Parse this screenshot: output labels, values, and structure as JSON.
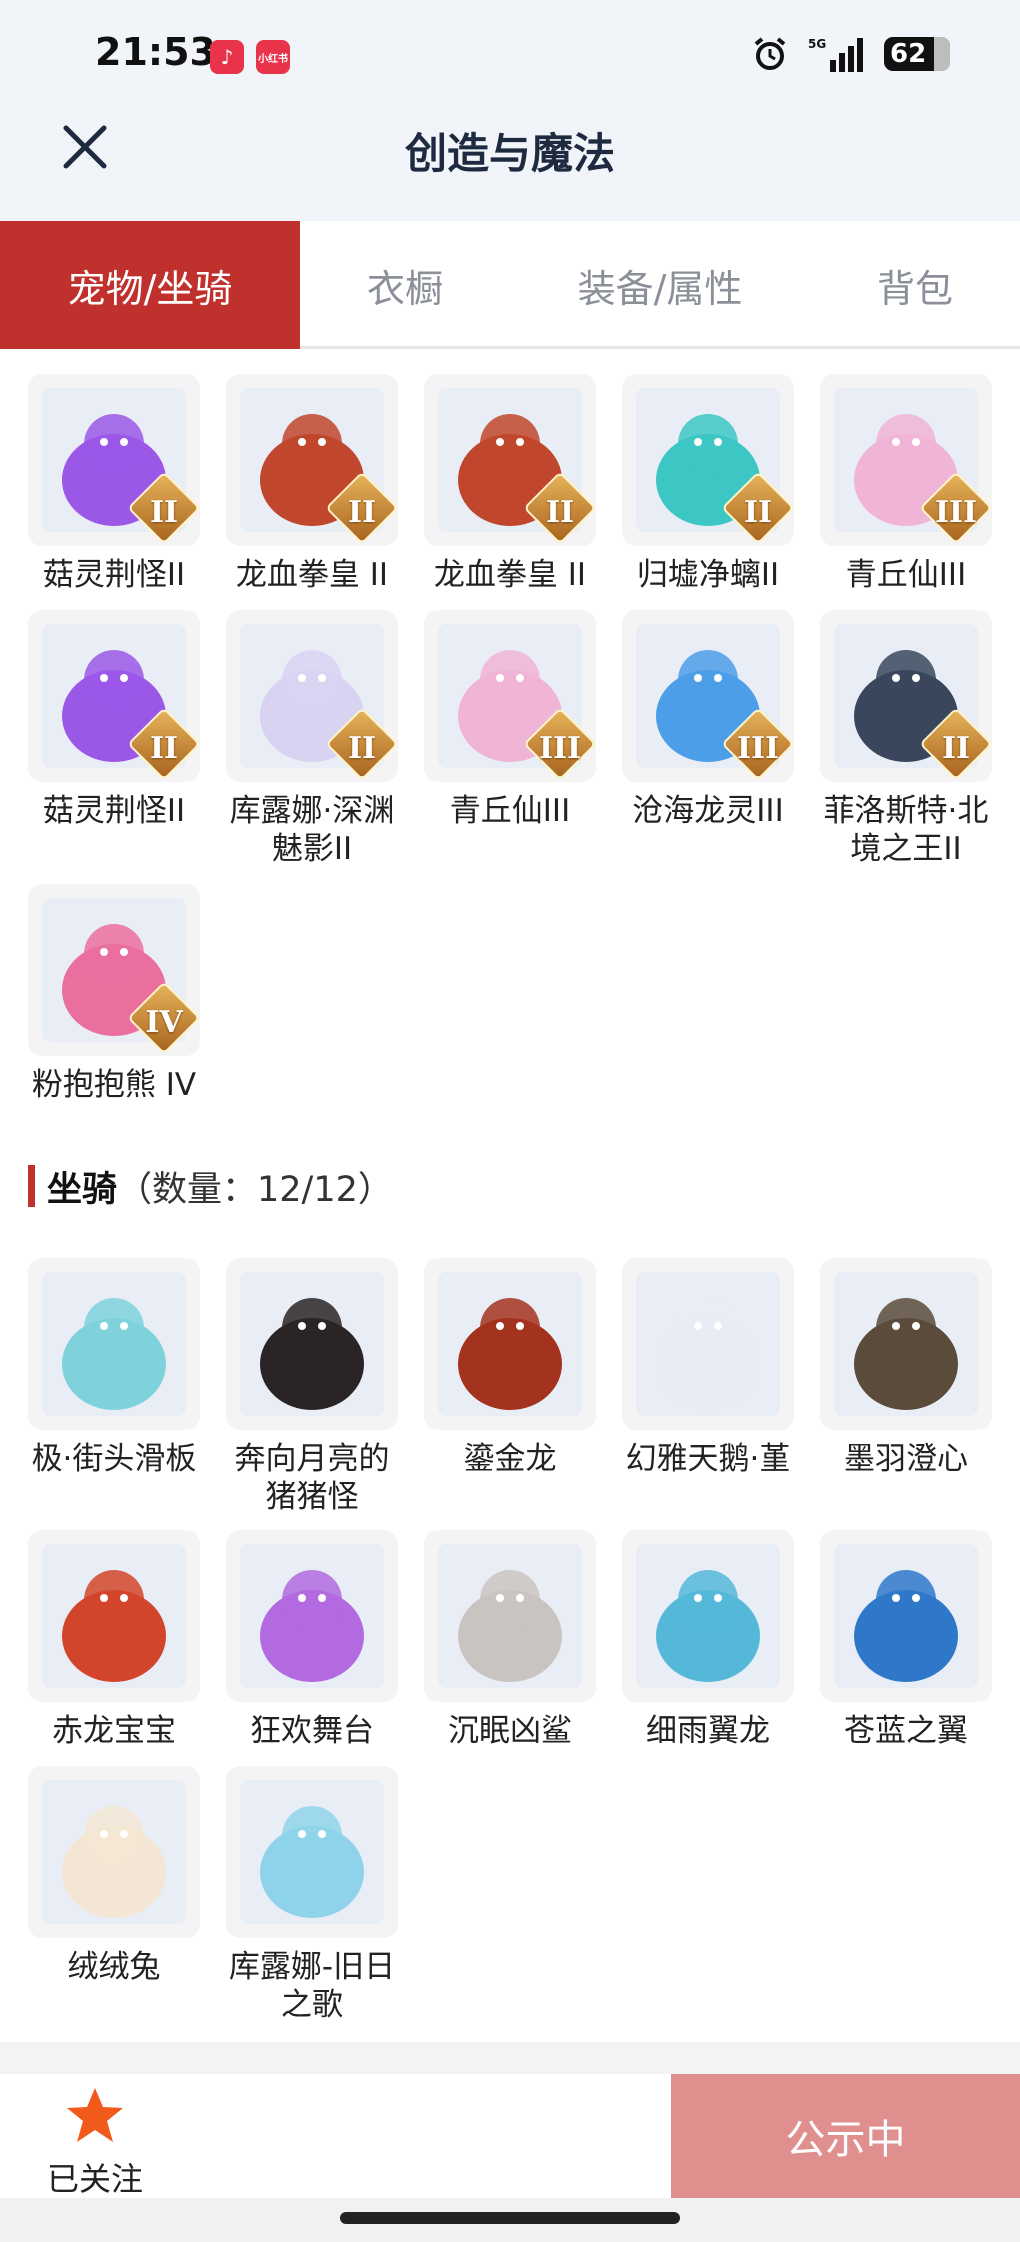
{
  "status_bar": {
    "time": "21:53",
    "app_icon_1": "♪",
    "app_icon_2": "小红书",
    "network": "5G",
    "battery": "62"
  },
  "header": {
    "title": "创造与魔法"
  },
  "tabs": [
    {
      "label": "宠物/坐骑",
      "active": true
    },
    {
      "label": "衣橱",
      "active": false
    },
    {
      "label": "装备/属性",
      "active": false
    },
    {
      "label": "背包",
      "active": false
    }
  ],
  "pets": [
    {
      "name": "菇灵荆怪II",
      "badge": "II",
      "icon": "purple-mushroom-sprite",
      "color": "#9b57e6"
    },
    {
      "name": "龙血拳皇 II",
      "badge": "II",
      "icon": "red-dragon-fighter",
      "color": "#c0462d"
    },
    {
      "name": "龙血拳皇 II",
      "badge": "II",
      "icon": "red-dragon-fighter",
      "color": "#c0462d"
    },
    {
      "name": "归墟净螭II",
      "badge": "II",
      "icon": "teal-water-dragon",
      "color": "#3cc7c4"
    },
    {
      "name": "青丘仙III",
      "badge": "III",
      "icon": "pink-fox-fairy",
      "color": "#f0b4d6"
    },
    {
      "name": "菇灵荆怪II",
      "badge": "II",
      "icon": "purple-mushroom-sprite",
      "color": "#9b57e6"
    },
    {
      "name": "库露娜·深渊魅影II",
      "badge": "II",
      "icon": "white-haired-maiden",
      "color": "#d9d3f2"
    },
    {
      "name": "青丘仙III",
      "badge": "III",
      "icon": "pink-fox-fairy",
      "color": "#f0b4d6"
    },
    {
      "name": "沧海龙灵III",
      "badge": "III",
      "icon": "blue-dragon-spirit",
      "color": "#4c9ee8"
    },
    {
      "name": "菲洛斯特·北境之王II",
      "badge": "II",
      "icon": "frost-armored-king",
      "color": "#39465c"
    },
    {
      "name": "粉抱抱熊 IV",
      "badge": "IV",
      "icon": "pink-hug-bear",
      "color": "#ea6f9f"
    }
  ],
  "mounts_section": {
    "title": "坐骑",
    "count_label": "（数量：12/12）"
  },
  "mounts": [
    {
      "name": "极·街头滑板",
      "icon": "skateboard",
      "color": "#7fd2dc"
    },
    {
      "name": "奔向月亮的猪猪怪",
      "icon": "black-pig",
      "color": "#2a2426"
    },
    {
      "name": "鎏金龙",
      "icon": "golden-dragon-head",
      "color": "#a3331f"
    },
    {
      "name": "幻雅天鹅·堇",
      "icon": "white-swan",
      "color": "#e9ecf4"
    },
    {
      "name": "墨羽澄心",
      "icon": "feather-staff",
      "color": "#5b4b3b"
    },
    {
      "name": "赤龙宝宝",
      "icon": "baby-red-dragon",
      "color": "#d2452b"
    },
    {
      "name": "狂欢舞台",
      "icon": "carnival-stage",
      "color": "#b36ae0"
    },
    {
      "name": "沉眠凶鲨",
      "icon": "sleeping-shark",
      "color": "#c9c4c0"
    },
    {
      "name": "细雨翼龙",
      "icon": "rain-wyvern",
      "color": "#55b8d8"
    },
    {
      "name": "苍蓝之翼",
      "icon": "azure-wing-dragon",
      "color": "#2f78c9"
    },
    {
      "name": "绒绒兔",
      "icon": "fluffy-rabbit",
      "color": "#f3e6d4"
    },
    {
      "name": "库露娜-旧日之歌",
      "icon": "sheep-hat-girl",
      "color": "#8fd3ea"
    }
  ],
  "bottom_bar": {
    "follow_label": "已关注",
    "cta_label": "公示中"
  },
  "colors": {
    "accent": "#c0302c",
    "cta": "#de8f8e",
    "star": "#f25a1c",
    "header_bg": "#f1f4f8"
  }
}
